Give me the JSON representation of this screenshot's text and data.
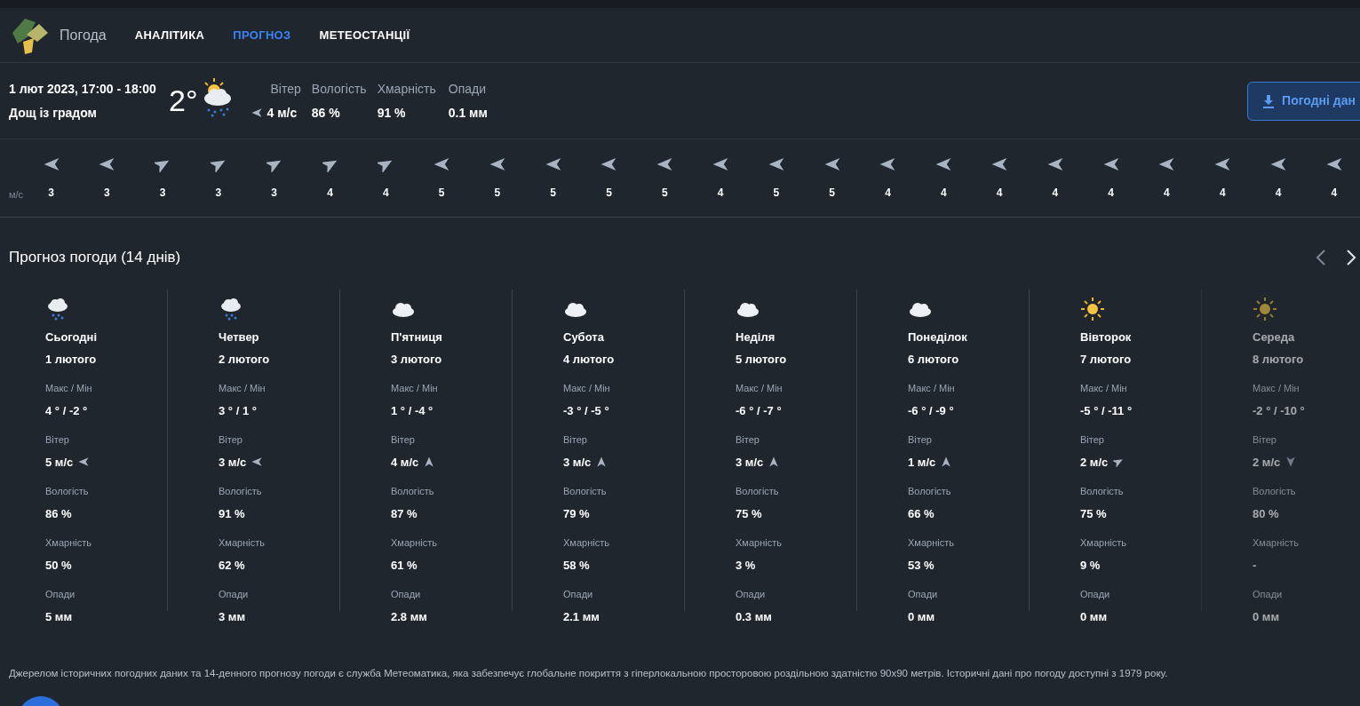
{
  "nav": {
    "title": "Погода",
    "tabs": [
      {
        "label": "АНАЛІТИКА",
        "selected": false
      },
      {
        "label": "ПРОГНОЗ",
        "selected": true
      },
      {
        "label": "МЕТЕОСТАНЦІЇ",
        "selected": false
      }
    ]
  },
  "current": {
    "datetime": "1 лют 2023, 17:00 - 18:00",
    "condition": "Дощ із градом",
    "temperature": "2°",
    "kind": "snow-sun",
    "metrics": [
      {
        "label": "Вітер",
        "value": "4 м/с",
        "kind": "left"
      },
      {
        "label": "Вологість",
        "value": "86 %"
      },
      {
        "label": "Хмарність",
        "value": "91 %"
      },
      {
        "label": "Опади",
        "value": "0.1 мм"
      }
    ],
    "button": "Погодні дан"
  },
  "wind_strip": {
    "unit": "м/с",
    "items": [
      {
        "value": "3",
        "kind": "left"
      },
      {
        "value": "3",
        "kind": "left"
      },
      {
        "value": "3",
        "kind": "up-right"
      },
      {
        "value": "3",
        "kind": "up-right"
      },
      {
        "value": "3",
        "kind": "up-right"
      },
      {
        "value": "4",
        "kind": "up-right"
      },
      {
        "value": "4",
        "kind": "up-right"
      },
      {
        "value": "5",
        "kind": "left"
      },
      {
        "value": "5",
        "kind": "left"
      },
      {
        "value": "5",
        "kind": "left"
      },
      {
        "value": "5",
        "kind": "left"
      },
      {
        "value": "5",
        "kind": "left"
      },
      {
        "value": "4",
        "kind": "left"
      },
      {
        "value": "5",
        "kind": "left"
      },
      {
        "value": "5",
        "kind": "left"
      },
      {
        "value": "4",
        "kind": "left"
      },
      {
        "value": "4",
        "kind": "left"
      },
      {
        "value": "4",
        "kind": "left"
      },
      {
        "value": "4",
        "kind": "left"
      },
      {
        "value": "4",
        "kind": "left"
      },
      {
        "value": "4",
        "kind": "left"
      },
      {
        "value": "4",
        "kind": "left"
      },
      {
        "value": "4",
        "kind": "left"
      },
      {
        "value": "4",
        "kind": "left"
      }
    ]
  },
  "forecast": {
    "title": "Прогноз погоди (14 днів)",
    "days": [
      {
        "kind": "snow",
        "day": "Сьогодні",
        "date": "1 лютого",
        "faded": false,
        "fields": [
          {
            "label": "Макс / Мін",
            "value": "4 ° / -2 °"
          },
          {
            "label": "Вітер",
            "value": "5 м/с",
            "kind": "left"
          },
          {
            "label": "Вологість",
            "value": "86 %"
          },
          {
            "label": "Хмарність",
            "value": "50 %"
          },
          {
            "label": "Опади",
            "value": "5 мм"
          }
        ]
      },
      {
        "kind": "snow",
        "day": "Четвер",
        "date": "2 лютого",
        "faded": false,
        "fields": [
          {
            "label": "Макс / Мін",
            "value": "3 ° / 1 °"
          },
          {
            "label": "Вітер",
            "value": "3 м/с",
            "kind": "left"
          },
          {
            "label": "Вологість",
            "value": "91 %"
          },
          {
            "label": "Хмарність",
            "value": "62 %"
          },
          {
            "label": "Опади",
            "value": "3 мм"
          }
        ]
      },
      {
        "kind": "cloud",
        "day": "П'ятниця",
        "date": "3 лютого",
        "faded": false,
        "fields": [
          {
            "label": "Макс / Мін",
            "value": "1 ° / -4 °"
          },
          {
            "label": "Вітер",
            "value": "4 м/с",
            "kind": "up"
          },
          {
            "label": "Вологість",
            "value": "87 %"
          },
          {
            "label": "Хмарність",
            "value": "61 %"
          },
          {
            "label": "Опади",
            "value": "2.8 мм"
          }
        ]
      },
      {
        "kind": "cloud",
        "day": "Субота",
        "date": "4 лютого",
        "faded": false,
        "fields": [
          {
            "label": "Макс / Мін",
            "value": "-3 ° / -5 °"
          },
          {
            "label": "Вітер",
            "value": "3 м/с",
            "kind": "up"
          },
          {
            "label": "Вологість",
            "value": "79 %"
          },
          {
            "label": "Хмарність",
            "value": "58 %"
          },
          {
            "label": "Опади",
            "value": "2.1 мм"
          }
        ]
      },
      {
        "kind": "cloud",
        "day": "Неділя",
        "date": "5 лютого",
        "faded": false,
        "fields": [
          {
            "label": "Макс / Мін",
            "value": "-6 ° / -7 °"
          },
          {
            "label": "Вітер",
            "value": "3 м/с",
            "kind": "up"
          },
          {
            "label": "Вологість",
            "value": "75 %"
          },
          {
            "label": "Хмарність",
            "value": "3 %"
          },
          {
            "label": "Опади",
            "value": "0.3 мм"
          }
        ]
      },
      {
        "kind": "cloud",
        "day": "Понеділок",
        "date": "6 лютого",
        "faded": false,
        "fields": [
          {
            "label": "Макс / Мін",
            "value": "-6 ° / -9 °"
          },
          {
            "label": "Вітер",
            "value": "1 м/с",
            "kind": "up"
          },
          {
            "label": "Вологість",
            "value": "66 %"
          },
          {
            "label": "Хмарність",
            "value": "53 %"
          },
          {
            "label": "Опади",
            "value": "0 мм"
          }
        ]
      },
      {
        "kind": "sun",
        "day": "Вівторок",
        "date": "7 лютого",
        "faded": false,
        "fields": [
          {
            "label": "Макс / Мін",
            "value": "-5 ° / -11 °"
          },
          {
            "label": "Вітер",
            "value": "2 м/с",
            "kind": "up-right"
          },
          {
            "label": "Вологість",
            "value": "75 %"
          },
          {
            "label": "Хмарність",
            "value": "9 %"
          },
          {
            "label": "Опади",
            "value": "0 мм"
          }
        ]
      },
      {
        "kind": "sun",
        "day": "Середа",
        "date": "8 лютого",
        "faded": true,
        "fields": [
          {
            "label": "Макс / Мін",
            "value": "-2 ° / -10 °"
          },
          {
            "label": "Вітер",
            "value": "2 м/с",
            "kind": "down"
          },
          {
            "label": "Вологість",
            "value": "80 %"
          },
          {
            "label": "Хмарність",
            "value": "-"
          },
          {
            "label": "Опади",
            "value": "0 мм"
          }
        ]
      }
    ]
  },
  "footer": "Джерелом історичних погодних даних та 14-денного прогнозу погоди є служба Метеоматика, яка забезпечує глобальне покриття з гіперлокальною просторовою роздільною здатністю 90x90 метрів. Історичні дані про погоду доступні з 1979 року."
}
